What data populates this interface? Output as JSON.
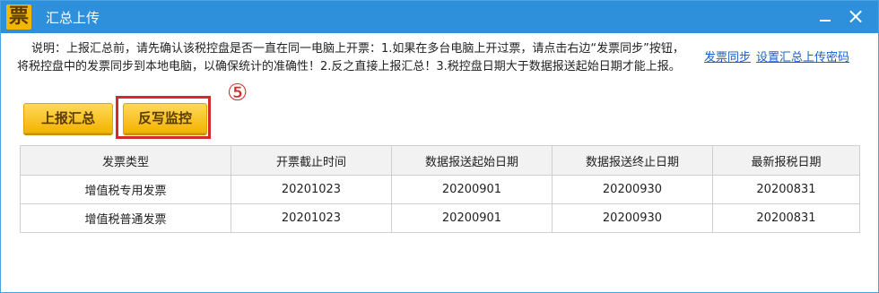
{
  "window": {
    "icon_char": "票",
    "title": "汇总上传",
    "minimize_label": "",
    "close_label": "×"
  },
  "description": "说明：上报汇总前，请先确认该税控盘是否一直在同一电脑上开票：1.如果在多台电脑上开过票，请点击右边“发票同步”按钮，将税控盘中的发票同步到本地电脑，以确保统计的准确性！2.反之直接上报汇总！3.税控盘日期大于数据报送起始日期才能上报。",
  "links": {
    "invoice_sync": "发票同步",
    "settings": "设置汇总上传密码"
  },
  "buttons": {
    "upload_summary": "上报汇总",
    "write_back": "反写监控"
  },
  "annotation": {
    "step_marker": "⑤",
    "highlight_color": "#d42a2a"
  },
  "table": {
    "headers": [
      "发票类型",
      "开票截止时间",
      "数据报送起始日期",
      "数据报送终止日期",
      "最新报税日期"
    ],
    "rows": [
      [
        "增值税专用发票",
        "20201023",
        "20200901",
        "20200930",
        "20200831"
      ],
      [
        "增值税普通发票",
        "20201023",
        "20200901",
        "20200930",
        "20200831"
      ]
    ]
  },
  "colors": {
    "titlebar": "#2e8fdb",
    "button": "#f4b300",
    "link": "#1a5fd0"
  }
}
